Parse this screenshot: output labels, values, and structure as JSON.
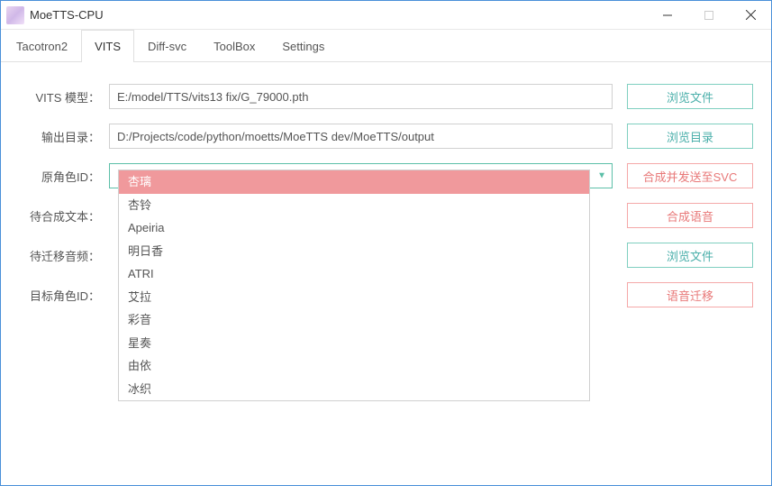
{
  "window": {
    "title": "MoeTTS-CPU"
  },
  "tabs": {
    "tacotron2": "Tacotron2",
    "vits": "VITS",
    "diffsvc": "Diff-svc",
    "toolbox": "ToolBox",
    "settings": "Settings"
  },
  "labels": {
    "model": "VITS 模型：",
    "output": "输出目录：",
    "source_char": "原角色ID：",
    "text": "待合成文本：",
    "audio": "待迁移音频：",
    "target_char": "目标角色ID："
  },
  "values": {
    "model_path": "E:/model/TTS/vits13 fix/G_79000.pth",
    "output_path": "D:/Projects/code/python/moetts/MoeTTS dev/MoeTTS/output"
  },
  "buttons": {
    "browse_file": "浏览文件",
    "browse_dir": "浏览目录",
    "synth_send_svc": "合成并发送至SVC",
    "synth_voice": "合成语音",
    "browse_file2": "浏览文件",
    "voice_transfer": "语音迁移"
  },
  "dropdown": {
    "items": [
      "杏璃",
      "杏铃",
      "Apeiria",
      "明日香",
      "ATRI",
      "艾拉",
      "彩音",
      "星奏",
      "由依",
      "冰织"
    ]
  }
}
